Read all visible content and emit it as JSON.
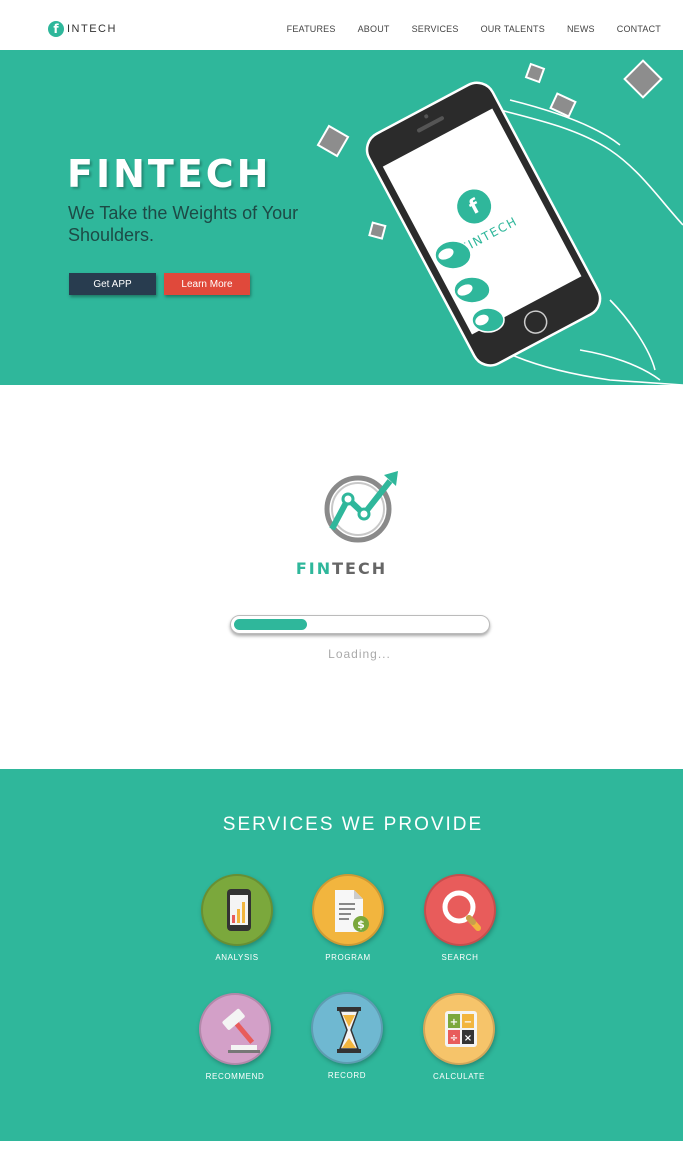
{
  "nav": {
    "logo_mark": "f",
    "logo_text": "INTECH",
    "items": [
      "FEATURES",
      "ABOUT",
      "SERVICES",
      "OUR TALENTS",
      "NEWS",
      "CONTACT"
    ]
  },
  "hero": {
    "title": "FINTECH",
    "subtitle": "We Take the Weights of Your Shoulders.",
    "get_app_label": "Get APP",
    "learn_more_label": "Learn More",
    "phone_brand": "FINTECH"
  },
  "loading": {
    "brand_fin": "FIN",
    "brand_tech": "TECH",
    "progress": 0.29,
    "status_text": "Loading..."
  },
  "services": {
    "title": "SERVICES WE PROVIDE",
    "items": [
      {
        "label": "ANALYSIS",
        "icon": "phone-chart-icon",
        "color": "#7ba83c"
      },
      {
        "label": "PROGRAM",
        "icon": "document-dollar-icon",
        "color": "#f2b53e"
      },
      {
        "label": "SEARCH",
        "icon": "magnifier-icon",
        "color": "#e85c5b"
      },
      {
        "label": "RECOMMEND",
        "icon": "gavel-icon",
        "color": "#d3a0c8"
      },
      {
        "label": "RECORD",
        "icon": "hourglass-icon",
        "color": "#6fb8d1"
      },
      {
        "label": "CALCULATE",
        "icon": "calculator-icon",
        "color": "#f6c46a"
      }
    ]
  },
  "colors": {
    "accent": "#2fb79b",
    "dark_button": "#283c4f",
    "red_button": "#e0493b"
  }
}
